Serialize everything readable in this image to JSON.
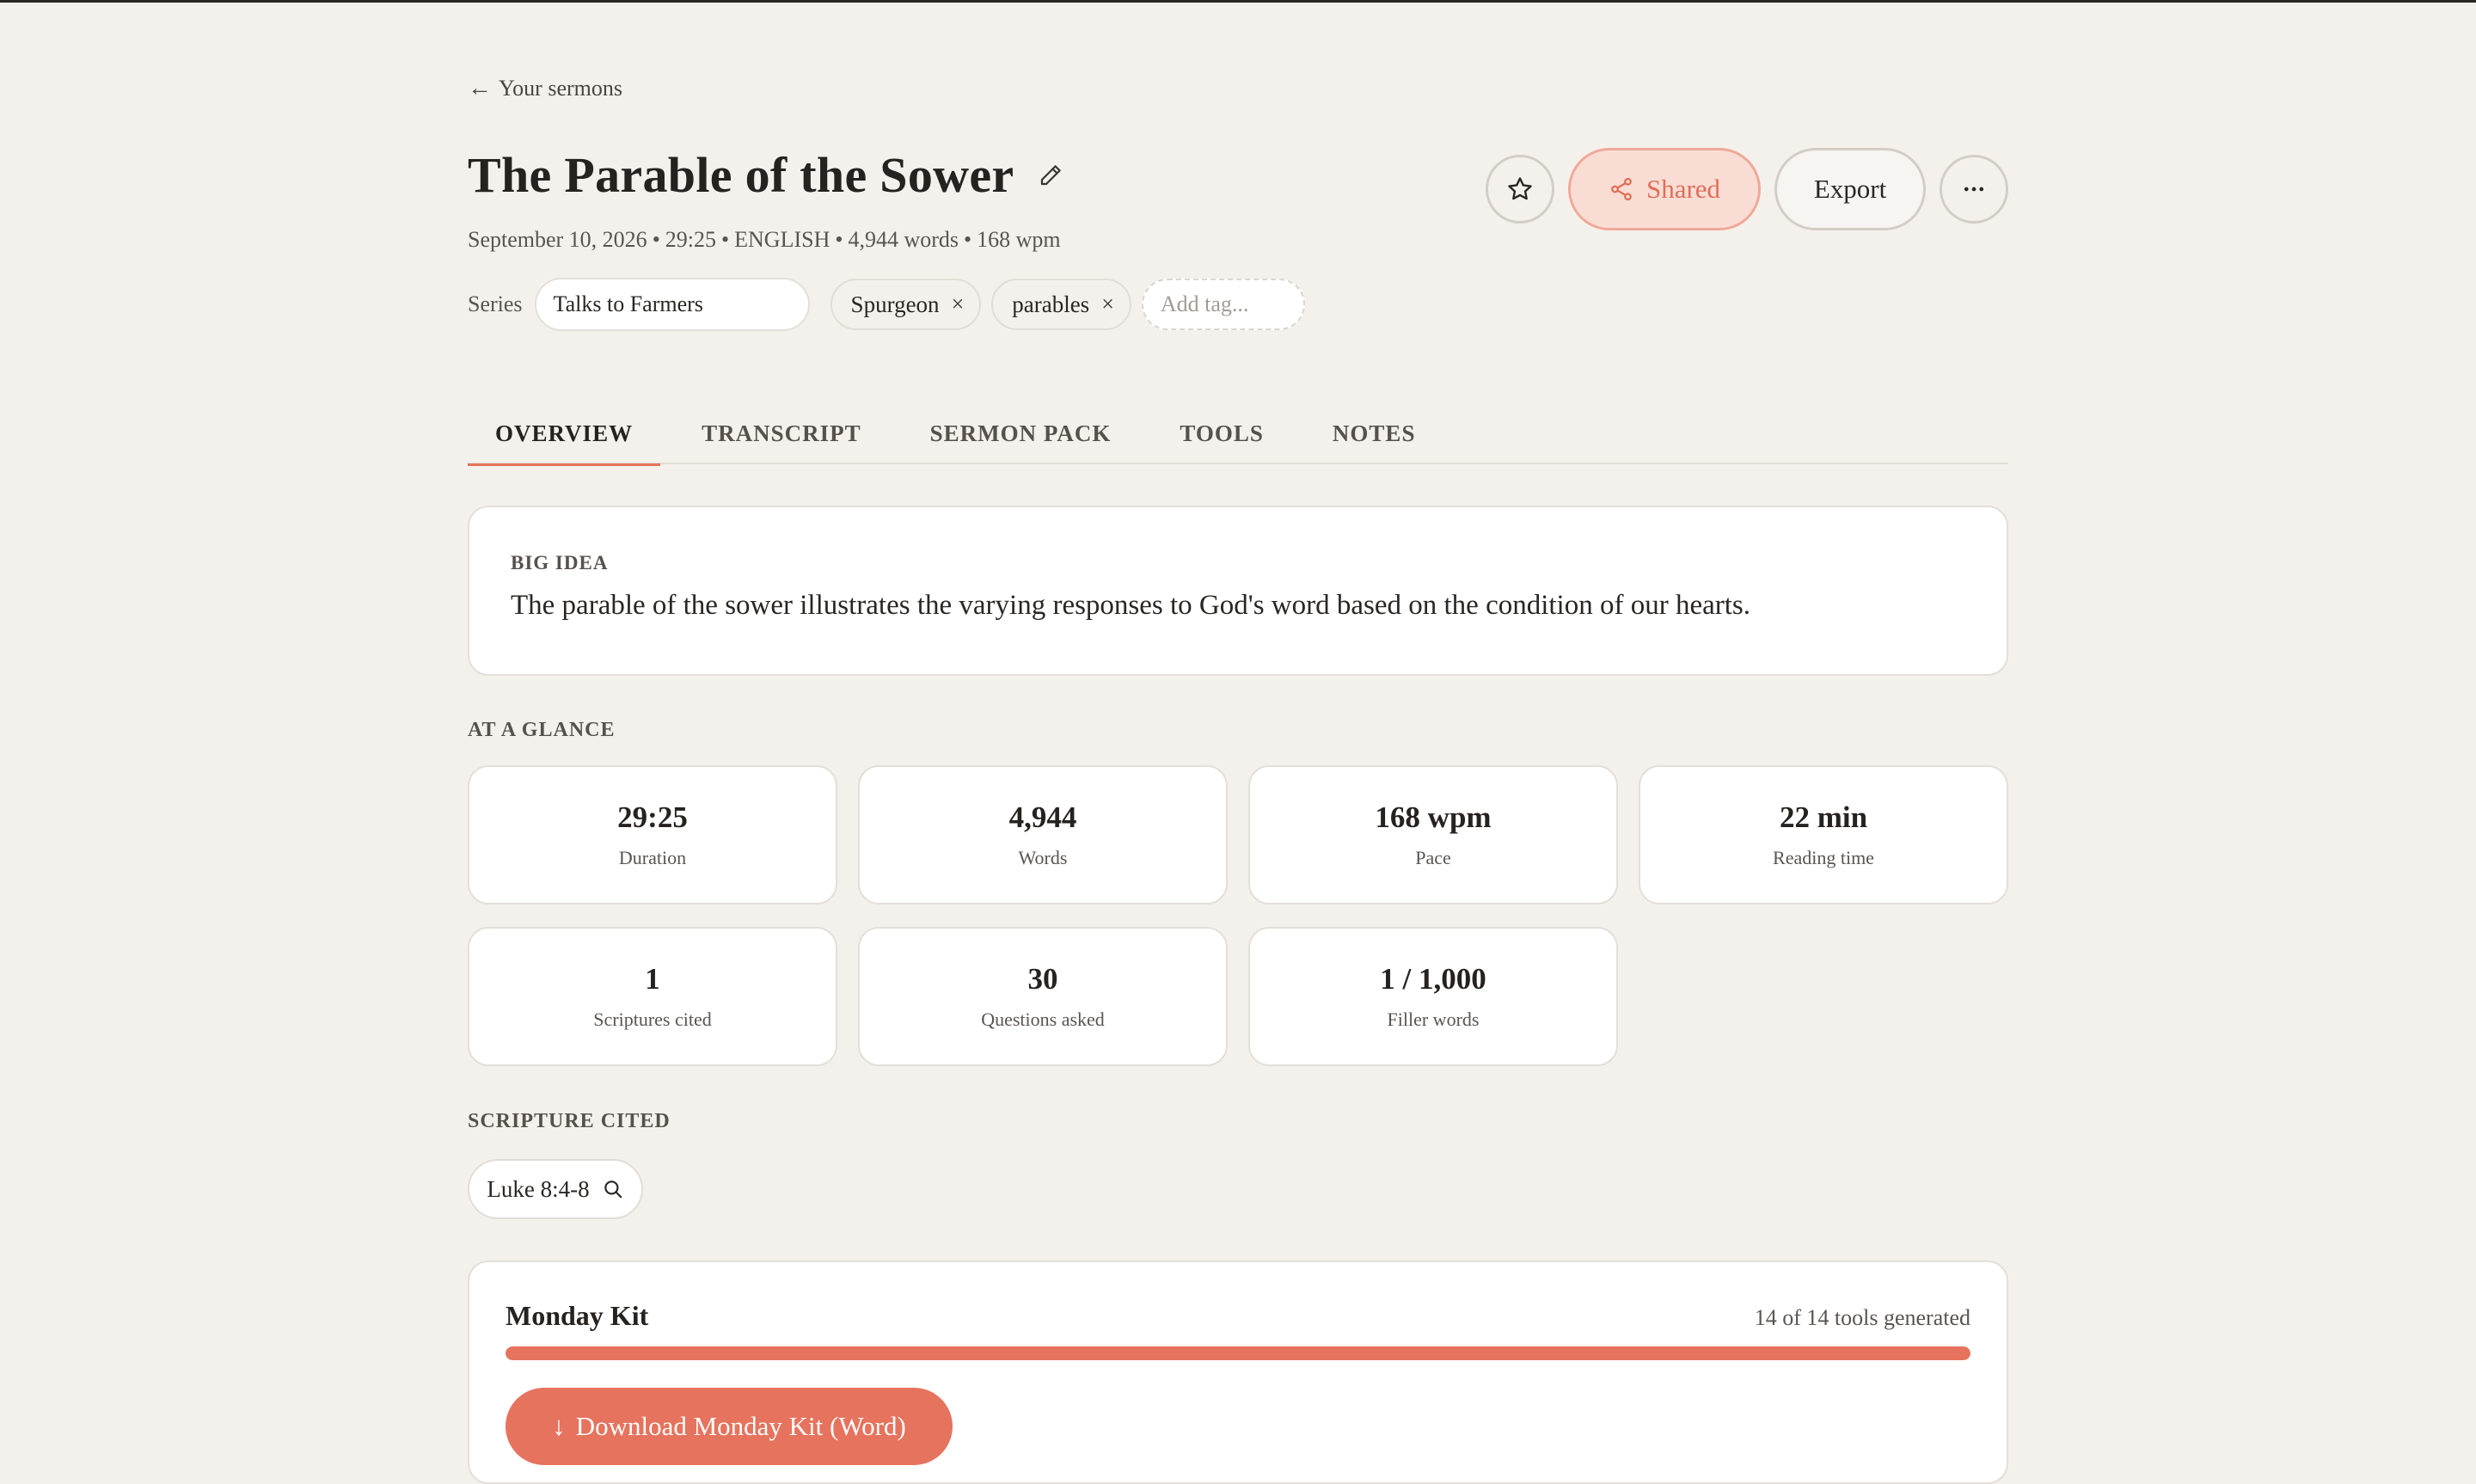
{
  "nav": {
    "back_arrow": "←",
    "back_label": "Your sermons"
  },
  "sermon": {
    "title": "The Parable of the Sower",
    "date": "September 10, 2026",
    "duration": "29:25",
    "language": "ENGLISH",
    "words": "4,944 words",
    "pace": "168 wpm",
    "meta_separator": "•"
  },
  "tags": {
    "series_label": "Series",
    "series_value": "Talks to Farmers",
    "items": [
      {
        "label": "Spurgeon",
        "remove": "×"
      },
      {
        "label": "parables",
        "remove": "×"
      }
    ],
    "add_placeholder": "Add tag..."
  },
  "actions": {
    "favorite_icon": "star-icon",
    "shared_label": "Shared",
    "shared_icon": "share-icon",
    "export_label": "Export",
    "more_icon": "more-horizontal-icon"
  },
  "tabs": [
    "OVERVIEW",
    "TRANSCRIPT",
    "SERMON PACK",
    "TOOLS",
    "NOTES"
  ],
  "active_tab": "OVERVIEW",
  "big_idea": {
    "label": "BIG IDEA",
    "text": "The parable of the sower illustrates the varying responses to God's word based on the condition of our hearts."
  },
  "at_a_glance": {
    "label": "AT A GLANCE",
    "stats": [
      {
        "value": "29:25",
        "label": "Duration"
      },
      {
        "value": "4,944",
        "label": "Words"
      },
      {
        "value": "168 wpm",
        "label": "Pace"
      },
      {
        "value": "22 min",
        "label": "Reading time"
      },
      {
        "value": "1",
        "label": "Scriptures cited"
      },
      {
        "value": "30",
        "label": "Questions asked"
      },
      {
        "value": "1 / 1,000",
        "label": "Filler words"
      }
    ]
  },
  "scripture": {
    "label": "SCRIPTURE CITED",
    "items": [
      {
        "ref": "Luke 8:4-8",
        "icon": "search-icon"
      }
    ]
  },
  "monday_kit": {
    "title": "Monday Kit",
    "status": "14 of 14 tools generated",
    "progress": 1.0,
    "download_icon": "↓",
    "download_label": "Download Monday Kit (Word)"
  },
  "colors": {
    "background": "#f4f1ec",
    "accent": "#e6735d",
    "accent_soft": "#f9ddd5",
    "text": "#26221f",
    "muted": "#5a5450"
  }
}
